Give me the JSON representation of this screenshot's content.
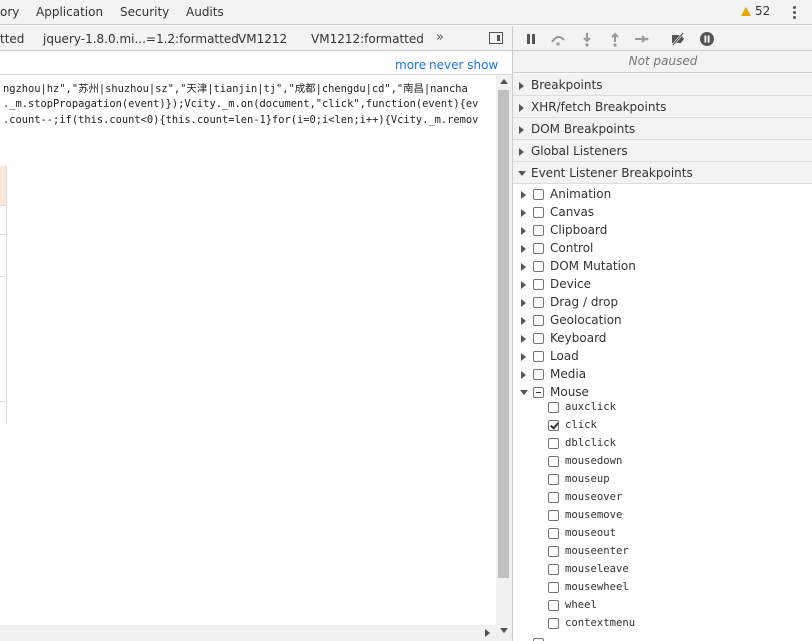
{
  "top_tabs": [
    "ory",
    "Application",
    "Security",
    "Audits"
  ],
  "warnings": {
    "count": "52",
    "icon": "warning-triangle-icon",
    "color": "#e8a600"
  },
  "file_tabs": [
    "tted",
    "jquery-1.8.0.mi...=1.2:formatted",
    "VM1212",
    "VM1212:formatted"
  ],
  "infobar": {
    "more": "more",
    "never_show": "never show"
  },
  "code_lines": [
    "ngzhou|hz\",\"苏州|shuzhou|sz\",\"天津|tianjin|tj\",\"成都|chengdu|cd\",\"南昌|nancha",
    "._m.stopPropagation(event)});Vcity._m.on(document,\"click\",function(event){ev",
    ".count--;if(this.count<0){this.count=len-1}for(i=0;i<len;i++){Vcity._m.remov"
  ],
  "debugger": {
    "status": "Not paused",
    "sections": [
      "Breakpoints",
      "XHR/fetch Breakpoints",
      "DOM Breakpoints",
      "Global Listeners",
      "Event Listener Breakpoints"
    ],
    "categories": [
      "Animation",
      "Canvas",
      "Clipboard",
      "Control",
      "DOM Mutation",
      "Device",
      "Drag / drop",
      "Geolocation",
      "Keyboard",
      "Load",
      "Media",
      "Mouse"
    ],
    "mouse_events": [
      "auxclick",
      "click",
      "dblclick",
      "mousedown",
      "mouseup",
      "mouseover",
      "mousemove",
      "mouseout",
      "mouseenter",
      "mouseleave",
      "mousewheel",
      "wheel",
      "contextmenu"
    ],
    "checked_event": "click",
    "expanded_category": "Mouse"
  },
  "colors": {
    "link": "#1a73e8",
    "toolbar_bg": "#f3f3f3",
    "accent": "#e8a600"
  }
}
